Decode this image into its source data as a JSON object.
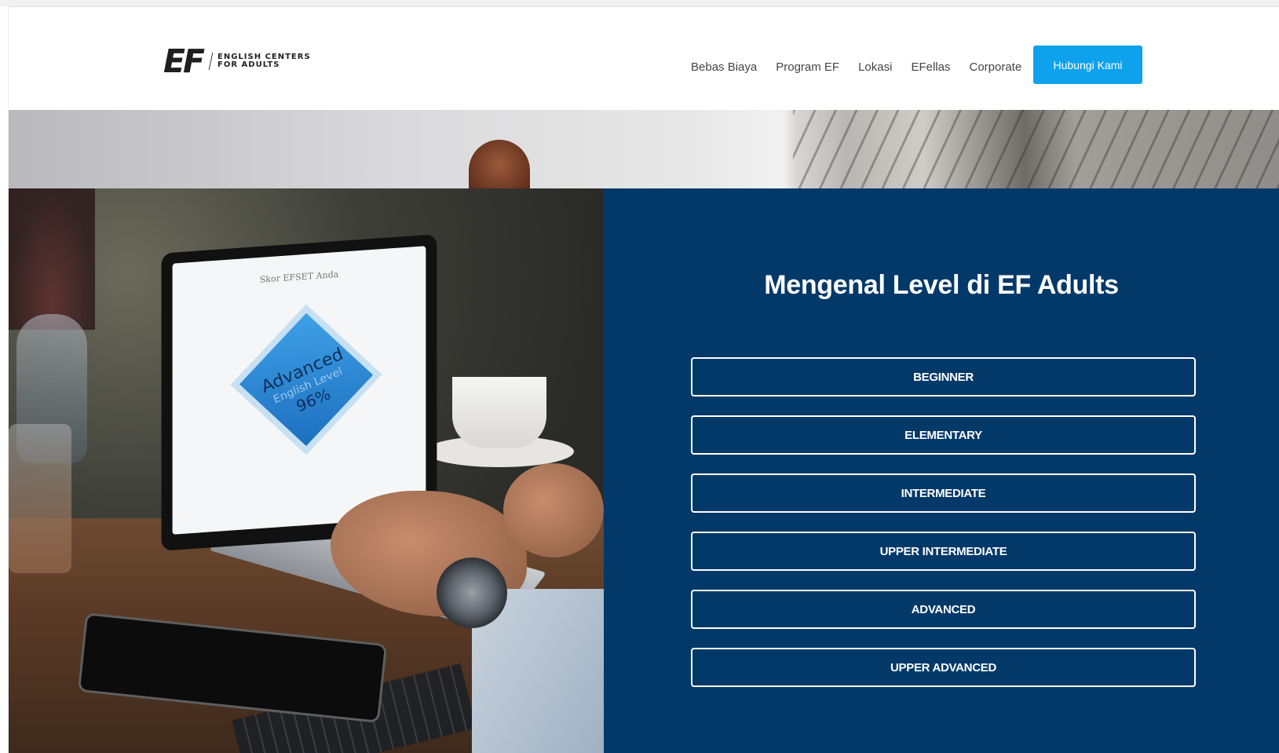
{
  "header": {
    "logo": {
      "mark": "EF",
      "text_line1": "ENGLISH CENTERS",
      "text_line2": "FOR ADULTS"
    },
    "nav": [
      {
        "label": "Bebas Biaya"
      },
      {
        "label": "Program EF"
      },
      {
        "label": "Lokasi"
      },
      {
        "label": "EFellas"
      },
      {
        "label": "Corporate"
      }
    ],
    "cta_label": "Hubungi Kami"
  },
  "hero": {
    "laptop_display": {
      "caption": "Skor EFSET Anda",
      "level": "Advanced",
      "sub": "English Level",
      "percent": "96%"
    }
  },
  "levels_section": {
    "title": "Mengenal Level di EF Adults",
    "levels": [
      {
        "label": "BEGINNER"
      },
      {
        "label": "ELEMENTARY"
      },
      {
        "label": "INTERMEDIATE"
      },
      {
        "label": "UPPER INTERMEDIATE"
      },
      {
        "label": "ADVANCED"
      },
      {
        "label": "UPPER ADVANCED"
      }
    ]
  },
  "colors": {
    "panel_bg": "#033969",
    "cta_bg": "#0ea2ec",
    "nav_text": "#444444"
  }
}
